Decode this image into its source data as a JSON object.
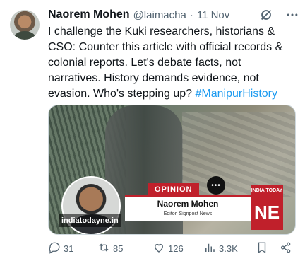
{
  "author": {
    "name": "Naorem Mohen",
    "handle": "@laimacha",
    "separator": "·",
    "date": "11 Nov"
  },
  "tweet": {
    "text": "I challenge the Kuki researchers, historians & CSO: Counter this article with official records & colonial reports. Let's debate facts, not narratives. History demands evidence, not evasion. Who's stepping up? ",
    "hashtag": "#ManipurHistory"
  },
  "media": {
    "opinion_label": "OPINION",
    "card_name": "Naorem Mohen",
    "card_role": "Editor, Signpost News",
    "source": "indiatodayne.in",
    "logo_top": "INDIA TODAY",
    "logo_main": "NE"
  },
  "actions": {
    "replies": "31",
    "reposts": "85",
    "likes": "126",
    "views": "3.3K"
  },
  "colors": {
    "accent": "#1d9bf0",
    "muted": "#536471",
    "brand_red": "#c0202b"
  },
  "icons": [
    "grok-icon",
    "more-icon",
    "reply-icon",
    "repost-icon",
    "like-icon",
    "views-icon",
    "bookmark-icon",
    "share-icon"
  ]
}
